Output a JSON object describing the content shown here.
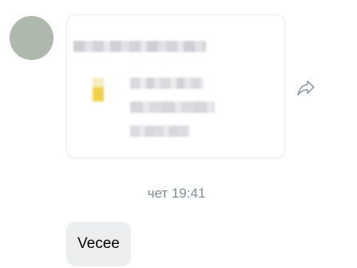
{
  "chat": {
    "attachment_card": {
      "title": "",
      "lines": []
    },
    "timestamp": "чет 19:41",
    "message": "Vecee"
  },
  "icons": {
    "share": "share-arrow-icon",
    "file": "document-icon"
  },
  "colors": {
    "avatar": "#aeb8ad",
    "bubble": "#edeef0",
    "timestamp": "#818c99",
    "file_icon": "#efd24a"
  }
}
